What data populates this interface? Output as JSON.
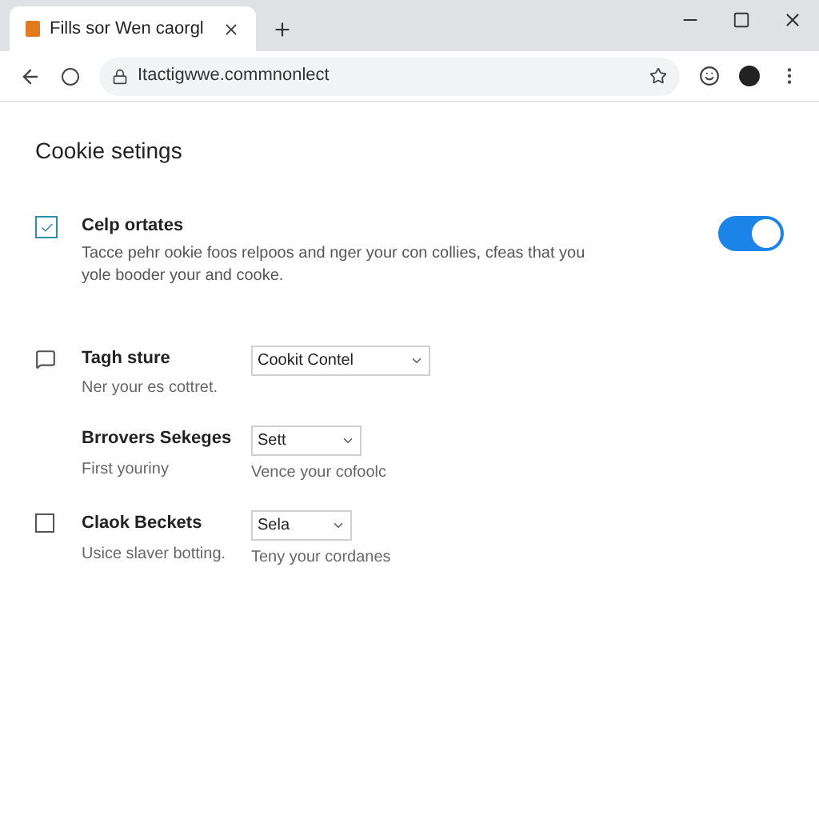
{
  "tab": {
    "title": "Fills sor Wen caorgl"
  },
  "address_bar": {
    "url": "Itactigwwe.commnonlect"
  },
  "page": {
    "heading": "Cookie setings"
  },
  "settings": [
    {
      "kind": "toggle",
      "title": "Celp ortates",
      "description": "Tacce pehr ookie foos relpoos and nger your con collies, cfeas that you yole booder your and cooke.",
      "on": true
    },
    {
      "kind": "select",
      "icon": true,
      "title": "Tagh sture",
      "subtitle": "Ner your es cottret.",
      "value": "Cookit Contel"
    },
    {
      "kind": "select",
      "icon": false,
      "title": "Brrovers Sekeges",
      "subtitle": "First youriny",
      "value": "Sett",
      "hint": "Vence your cofoolc"
    },
    {
      "kind": "checkbox",
      "title": "Claok Beckets",
      "subtitle": "Usice slaver botting.",
      "value": "Sela",
      "hint": "Teny your cordanes",
      "checked": false
    }
  ]
}
